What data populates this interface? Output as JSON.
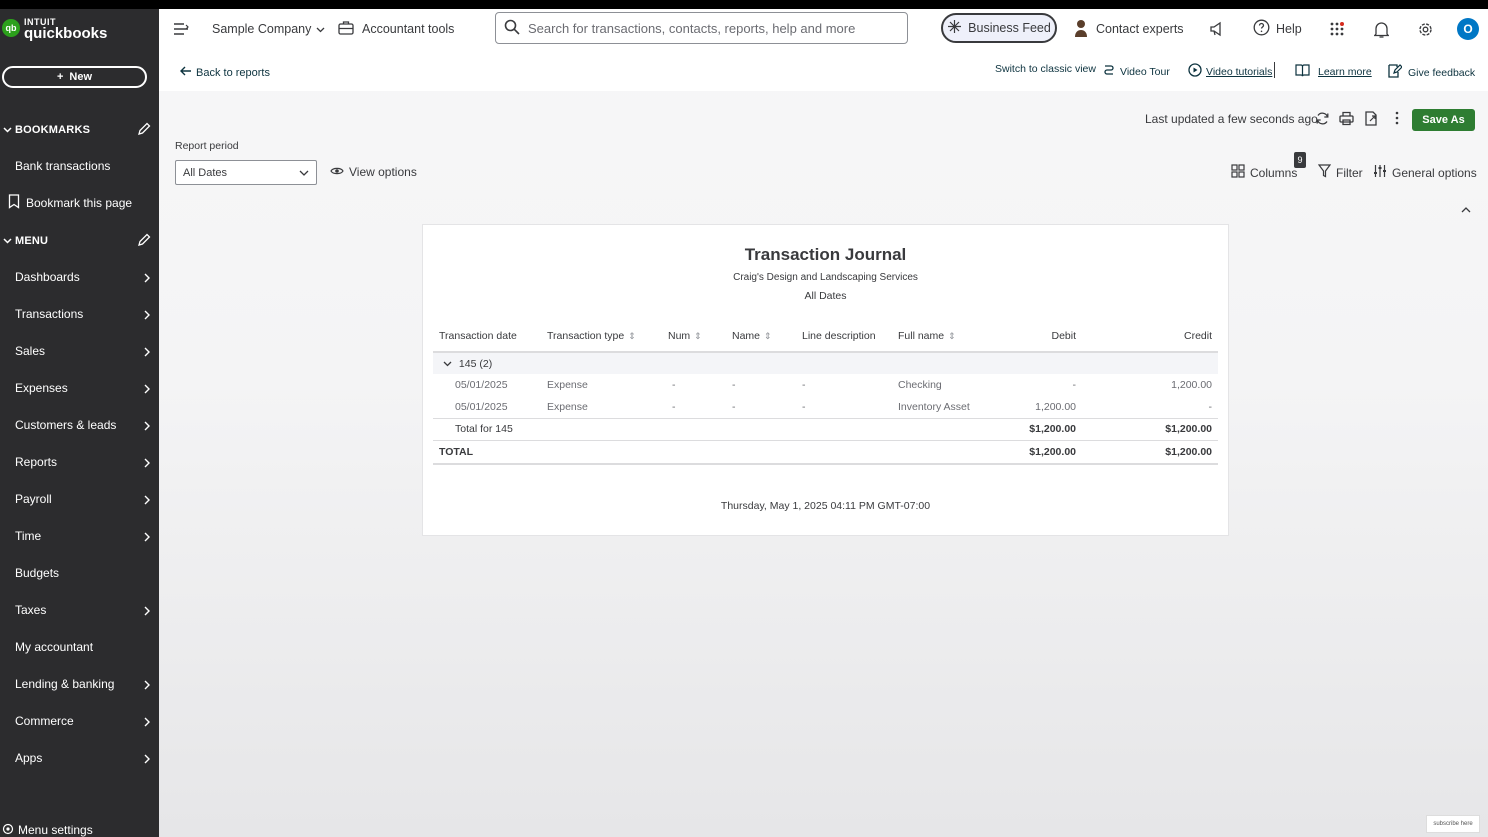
{
  "sidebar": {
    "logo_top": "INTUIT",
    "logo_bottom": "quickbooks",
    "new_label": "New",
    "bookmarks_title": "BOOKMARKS",
    "bookmarks": [
      {
        "label": "Bank transactions"
      },
      {
        "label": "Bookmark this page"
      }
    ],
    "menu_title": "MENU",
    "menu": [
      {
        "label": "Dashboards"
      },
      {
        "label": "Transactions"
      },
      {
        "label": "Sales"
      },
      {
        "label": "Expenses"
      },
      {
        "label": "Customers & leads"
      },
      {
        "label": "Reports"
      },
      {
        "label": "Payroll"
      },
      {
        "label": "Time"
      },
      {
        "label": "Budgets"
      },
      {
        "label": "Taxes"
      },
      {
        "label": "My accountant"
      },
      {
        "label": "Lending & banking"
      },
      {
        "label": "Commerce"
      },
      {
        "label": "Apps"
      }
    ],
    "menu_settings": "Menu settings"
  },
  "topbar": {
    "company": "Sample Company",
    "accountant_tools": "Accountant tools",
    "search_placeholder": "Search for transactions, contacts, reports, help and more",
    "business_feed": "Business Feed",
    "contact_experts": "Contact experts",
    "help": "Help",
    "avatar_letter": "O"
  },
  "subbar": {
    "back": "Back to reports",
    "classic": "Switch to classic view",
    "video_tour": "Video Tour",
    "video_tutorials": "Video tutorials",
    "learn_more": "Learn more",
    "feedback": "Give feedback"
  },
  "toolbar": {
    "last_updated": "Last updated a few seconds ago",
    "save_as": "Save As",
    "period_label": "Report period",
    "period_value": "All Dates",
    "view_options": "View options",
    "columns": "Columns",
    "columns_badge": "9",
    "filter": "Filter",
    "general_options": "General options"
  },
  "report": {
    "title": "Transaction Journal",
    "company": "Craig's Design and Landscaping Services",
    "period": "All Dates",
    "columns": [
      "Transaction date",
      "Transaction type",
      "Num",
      "Name",
      "Line description",
      "Full name",
      "Debit",
      "Credit"
    ],
    "group_label": "145 (2)",
    "rows": [
      {
        "date": "05/01/2025",
        "type": "Expense",
        "num": "-",
        "name": "-",
        "desc": "-",
        "full_name": "Checking",
        "debit": "-",
        "credit": "1,200.00"
      },
      {
        "date": "05/01/2025",
        "type": "Expense",
        "num": "-",
        "name": "-",
        "desc": "-",
        "full_name": "Inventory Asset",
        "debit": "1,200.00",
        "credit": "-"
      }
    ],
    "subtotal": {
      "label": "Total for 145",
      "debit": "$1,200.00",
      "credit": "$1,200.00"
    },
    "total": {
      "label": "TOTAL",
      "debit": "$1,200.00",
      "credit": "$1,200.00"
    },
    "timestamp": "Thursday, May 1, 2025 04:11 PM GMT-07:00"
  },
  "overlay": {
    "subscribe": "subscribe here"
  },
  "colors": {
    "sidebar_bg": "#2c2c2e",
    "brand_green": "#2ca01c",
    "save_button": "#2e7d32"
  }
}
